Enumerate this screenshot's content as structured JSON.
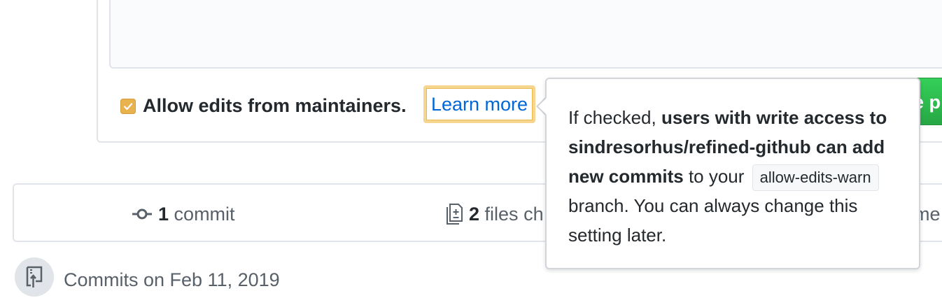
{
  "composer": {
    "checkbox_checked": true,
    "allow_edits_label": "Allow edits from maintainers.",
    "learn_more_link": "Learn more",
    "create_button_label": "e p"
  },
  "summary": {
    "commits_count": "1",
    "commits_label": "commit",
    "files_count": "2",
    "files_label": "files ch",
    "more_label": "me"
  },
  "timeline": {
    "commits_date_label": "Commits on Feb 11, 2019"
  },
  "tooltip": {
    "prefix": "If checked, ",
    "bold_text": "users with write access to sindresorhus/refined-github can add new commits",
    "middle": " to your ",
    "branch_name": "allow-edits-warn",
    "suffix": " branch. You can always change this setting later."
  },
  "colors": {
    "accent_link": "#0366d6",
    "checkbox": "#e8b24f",
    "focus_ring": "#f6d58f",
    "button_green": "#28a745"
  },
  "icons": {
    "checkbox": "check-icon",
    "commits": "git-commit-icon",
    "files": "file-diff-icon",
    "timeline": "repo-push-icon"
  }
}
